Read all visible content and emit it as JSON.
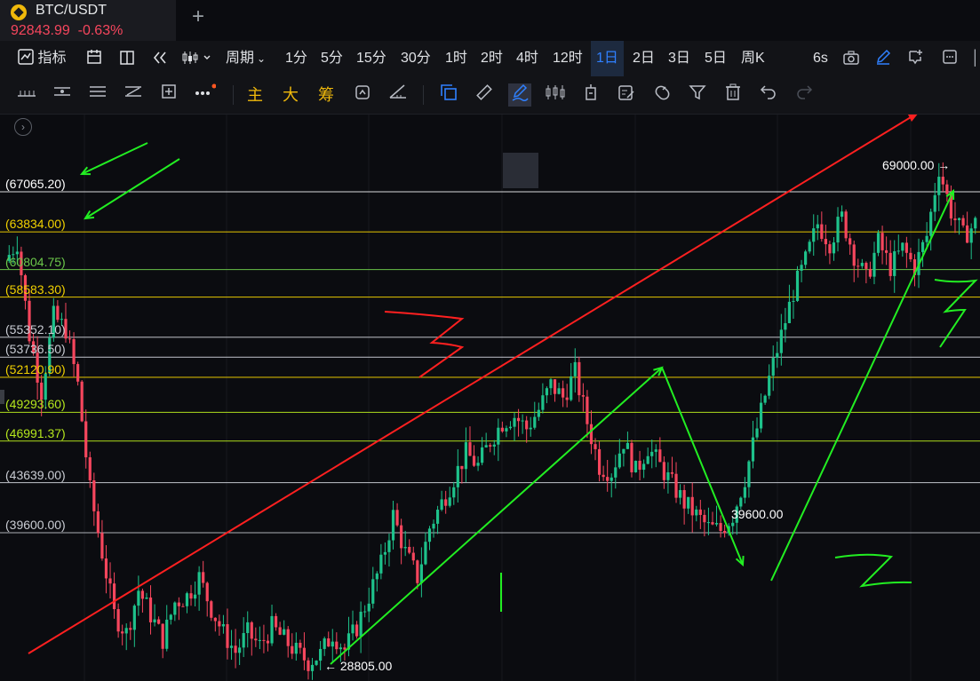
{
  "tab": {
    "symbol": "BTC/USDT",
    "price": "92843.99",
    "change": "-0.63%"
  },
  "toolbar": {
    "indicators_label": "指标",
    "period_label": "周期",
    "timeframes": [
      "1分",
      "5分",
      "15分",
      "30分",
      "1时",
      "2时",
      "4时",
      "12时",
      "1日",
      "2日",
      "3日",
      "5日",
      "周K"
    ],
    "active_timeframe": "1日",
    "refresh_label": "6s"
  },
  "drawing_toolbar": {
    "main_label": "主",
    "big_label": "大",
    "chips_label": "筹"
  },
  "levels": [
    {
      "label": "(67065.20)",
      "value": 67065.2,
      "color": "#ffffff"
    },
    {
      "label": "(63834.00)",
      "value": 63834.0,
      "color": "#f0d000"
    },
    {
      "label": "(60804.75)",
      "value": 60804.75,
      "color": "#6cc84a"
    },
    {
      "label": "(58583.30)",
      "value": 58583.3,
      "color": "#f0d000"
    },
    {
      "label": "(55352.10)",
      "value": 55352.1,
      "color": "#c9ccd3"
    },
    {
      "label": "(53736.50)",
      "value": 53736.5,
      "color": "#c9ccd3"
    },
    {
      "label": "(52120.90)",
      "value": 52120.9,
      "color": "#f0d000"
    },
    {
      "label": "(49293.60)",
      "value": 49293.6,
      "color": "#b5e61d"
    },
    {
      "label": "(46991.37)",
      "value": 46991.37,
      "color": "#b5e61d"
    },
    {
      "label": "(43639.00)",
      "value": 43639.0,
      "color": "#c9ccd3"
    },
    {
      "label": "(39600.00)",
      "value": 39600.0,
      "color": "#c9ccd3"
    }
  ],
  "annotations": {
    "high": "69000.00",
    "mid_low": "39600.00",
    "low": "28805.00"
  },
  "chart_data": {
    "type": "candlestick",
    "symbol": "BTC/USDT",
    "interval": "1日",
    "ylim": [
      27500,
      70500
    ],
    "high_marker": 69000.0,
    "low_marker": 28805.0,
    "swing_low_marker": 39600.0,
    "up_color": "#1ec28b",
    "down_color": "#f6465d",
    "path": [
      61500,
      63000,
      55500,
      51000,
      57000,
      56000,
      51500,
      43000,
      38000,
      33000,
      31500,
      35000,
      33000,
      31000,
      34000,
      34500,
      36000,
      33500,
      31500,
      30000,
      31500,
      30500,
      32000,
      31000,
      30000,
      29200,
      29800,
      31500,
      30200,
      32000,
      34500,
      37000,
      41000,
      38000,
      36000,
      40000,
      42000,
      44000,
      46000,
      45000,
      47000,
      48500,
      49000,
      48000,
      49500,
      51500,
      50500,
      52500,
      48500,
      45000,
      44500,
      47000,
      44500,
      46500,
      45000,
      43500,
      42000,
      41000,
      40000,
      39800,
      41000,
      44000,
      48000,
      52000,
      55500,
      59000,
      61500,
      64500,
      63000,
      65000,
      62000,
      60000,
      63000,
      61000,
      62500,
      61000,
      63500,
      69000,
      65500,
      63500,
      64500
    ]
  }
}
